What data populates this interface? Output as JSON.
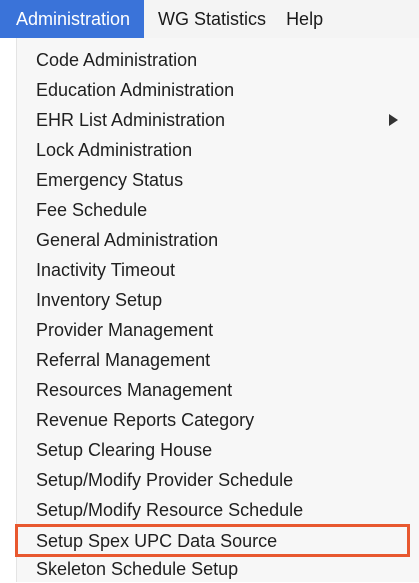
{
  "menubar": {
    "items": [
      {
        "label": "Administration"
      },
      {
        "label": "WG Statistics"
      },
      {
        "label": "Help"
      }
    ],
    "active_color": "#3a73d9"
  },
  "menu": {
    "items": [
      {
        "label": "Code Administration"
      },
      {
        "label": "Education Administration"
      },
      {
        "label": "EHR List Administration",
        "has_submenu": true
      },
      {
        "label": "Lock Administration"
      },
      {
        "label": "Emergency Status"
      },
      {
        "label": "Fee Schedule"
      },
      {
        "label": "General Administration"
      },
      {
        "label": "Inactivity Timeout"
      },
      {
        "label": "Inventory Setup"
      },
      {
        "label": "Provider Management"
      },
      {
        "label": "Referral Management"
      },
      {
        "label": "Resources Management"
      },
      {
        "label": "Revenue Reports Category"
      },
      {
        "label": "Setup Clearing House"
      },
      {
        "label": "Setup/Modify Provider Schedule"
      },
      {
        "label": "Setup/Modify Resource Schedule"
      },
      {
        "label": "Setup Spex UPC Data Source"
      },
      {
        "label": "Skeleton Schedule Setup"
      }
    ],
    "highlighted_item": "Setup Spex UPC Data Source",
    "highlight_color": "#e8582f"
  }
}
